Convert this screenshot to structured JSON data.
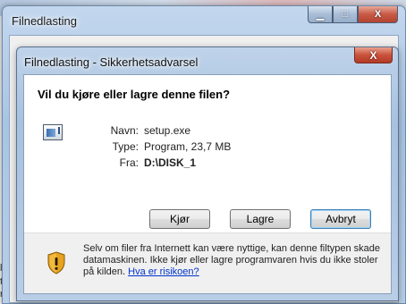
{
  "outer_window": {
    "title": "Filnedlasting",
    "minimize_glyph": "▁",
    "maximize_glyph": "□",
    "close_glyph": "X"
  },
  "background": {
    "edge_texts": [
      "l.",
      "te",
      "rlt"
    ]
  },
  "dialog": {
    "title": "Filnedlasting - Sikkerhetsadvarsel",
    "close_glyph": "X",
    "question": "Vil du kjøre eller lagre denne filen?",
    "file_icon": "program-file-icon",
    "fields": {
      "name_label": "Navn:",
      "name_value": "setup.exe",
      "type_label": "Type:",
      "type_value": "Program, 23,7 MB",
      "from_label": "Fra:",
      "from_value": "D:\\DISK_1"
    },
    "buttons": {
      "run": "Kjør",
      "save": "Lagre",
      "cancel": "Avbryt"
    },
    "warning": {
      "icon": "security-shield-icon",
      "text": "Selv om filer fra Internett kan være nyttige, kan denne filtypen skade datamaskinen. Ikke kjør eller lagre programvaren hvis du ikke stoler på kilden.",
      "link": "Hva er risikoen?"
    }
  }
}
